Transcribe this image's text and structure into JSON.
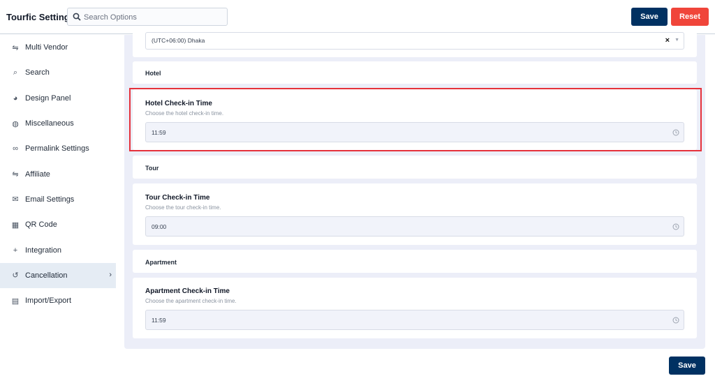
{
  "header": {
    "title": "Tourfic Settings",
    "search_placeholder": "Search Options",
    "save_label": "Save",
    "reset_label": "Reset"
  },
  "sidebar": {
    "items": [
      {
        "label": "Multi Vendor",
        "icon": "handshake-icon"
      },
      {
        "label": "Search",
        "icon": "search-icon"
      },
      {
        "label": "Design Panel",
        "icon": "palette-icon"
      },
      {
        "label": "Miscellaneous",
        "icon": "globe-icon"
      },
      {
        "label": "Permalink Settings",
        "icon": "link-icon"
      },
      {
        "label": "Affiliate",
        "icon": "handshake-icon"
      },
      {
        "label": "Email Settings",
        "icon": "envelope-icon"
      },
      {
        "label": "QR Code",
        "icon": "qr-code-icon"
      },
      {
        "label": "Integration",
        "icon": "plus-icon"
      },
      {
        "label": "Cancellation",
        "icon": "undo-icon",
        "active": true
      },
      {
        "label": "Import/Export",
        "icon": "database-icon"
      }
    ]
  },
  "main": {
    "timezone_value": "(UTC+06:00) Dhaka",
    "timezone_clear": "×",
    "hotel": {
      "section": "Hotel",
      "field_title": "Hotel Check-in Time",
      "field_desc": "Choose the hotel check-in time.",
      "value": "11:59"
    },
    "tour": {
      "section": "Tour",
      "field_title": "Tour Check-in Time",
      "field_desc": "Choose the tour check-in time.",
      "value": "09:00"
    },
    "apartment": {
      "section": "Apartment",
      "field_title": "Apartment Check-in Time",
      "field_desc": "Choose the apartment check-in time.",
      "value": "11:59"
    }
  },
  "footer": {
    "save_label": "Save"
  },
  "colors": {
    "primary": "#003162",
    "reset": "#f0453a",
    "highlight": "#e5313b",
    "panel_bg": "#eceef8"
  }
}
